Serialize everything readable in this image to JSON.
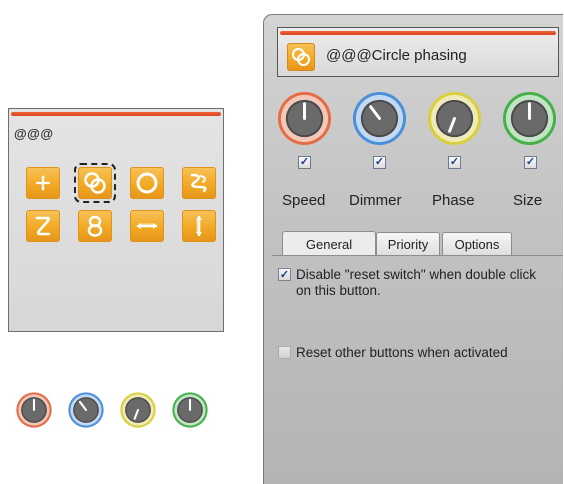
{
  "small_panel": {
    "title": "@@@",
    "effects": [
      {
        "icon": "move-arrow-icon",
        "selected": false
      },
      {
        "icon": "circle-phasing-icon",
        "selected": true
      },
      {
        "icon": "circle-icon",
        "selected": false
      },
      {
        "icon": "wave-icon",
        "selected": false
      },
      {
        "icon": "z-shape-icon",
        "selected": false
      },
      {
        "icon": "figure-eight-icon",
        "selected": false
      },
      {
        "icon": "horizontal-arrow-icon",
        "selected": false
      },
      {
        "icon": "vertical-arrow-icon",
        "selected": false
      }
    ],
    "knobs": [
      {
        "name": "speed",
        "color": "#e66a45"
      },
      {
        "name": "dimmer",
        "color": "#4a8fd9"
      },
      {
        "name": "phase",
        "color": "#d9cf3a"
      },
      {
        "name": "size",
        "color": "#43b04a"
      }
    ]
  },
  "big_panel": {
    "header": {
      "title": "@@@Circle phasing",
      "icon": "circle-phasing-icon"
    },
    "knobs": [
      {
        "label": "Speed",
        "color": "#e66a45",
        "checked": true
      },
      {
        "label": "Dimmer",
        "color": "#4a8fd9",
        "checked": true
      },
      {
        "label": "Phase",
        "color": "#d9cf3a",
        "checked": true
      },
      {
        "label": "Size",
        "color": "#43b04a",
        "checked": true
      }
    ],
    "tabs": [
      {
        "label": "General",
        "active": true
      },
      {
        "label": "Priority",
        "active": false
      },
      {
        "label": "Options",
        "active": false
      }
    ],
    "options": [
      {
        "label": "Disable \"reset switch\" when double click on this button.",
        "checked": true
      },
      {
        "label": "Reset other buttons when activated",
        "checked": false
      }
    ],
    "checkmark": "✓"
  }
}
